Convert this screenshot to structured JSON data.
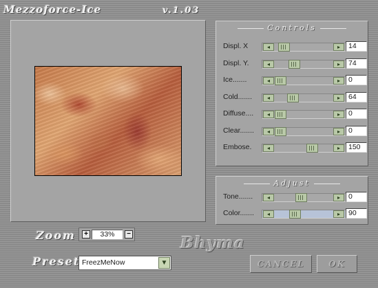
{
  "app": {
    "title": "Mezzoforce-Ice",
    "version": "v.1.03",
    "brand": "Bhyma"
  },
  "controls": {
    "heading": "Controls",
    "sliders": [
      {
        "label": "Displ. X",
        "value": "14",
        "level": 0.07
      },
      {
        "label": "Displ. Y.",
        "value": "74",
        "level": 0.3
      },
      {
        "label": "Ice.......",
        "value": "0",
        "level": 0.0
      },
      {
        "label": "Cold.......",
        "value": "64",
        "level": 0.27
      },
      {
        "label": "Diffuse....",
        "value": "0",
        "level": 0.0
      },
      {
        "label": "Clear.......",
        "value": "0",
        "level": 0.0
      },
      {
        "label": "Embose.",
        "value": "150",
        "level": 0.68
      }
    ]
  },
  "adjust": {
    "heading": "Adjust",
    "sliders": [
      {
        "label": "Tone.......",
        "value": "0",
        "level": 0.45
      },
      {
        "label": "Color.......",
        "value": "90",
        "level": 0.32
      }
    ]
  },
  "zoom": {
    "label": "Zoom",
    "value": "33%",
    "plus": "+",
    "minus": "−"
  },
  "preset": {
    "label": "Preset",
    "value": "FreezMeNow"
  },
  "buttons": {
    "cancel": "CANCEL",
    "ok": "OK"
  },
  "colors": {
    "background": "#8f8f8f",
    "panel": "#a4a4a4",
    "arrow_green": "#b9c9a8",
    "color_track": "#b7c3d8"
  }
}
